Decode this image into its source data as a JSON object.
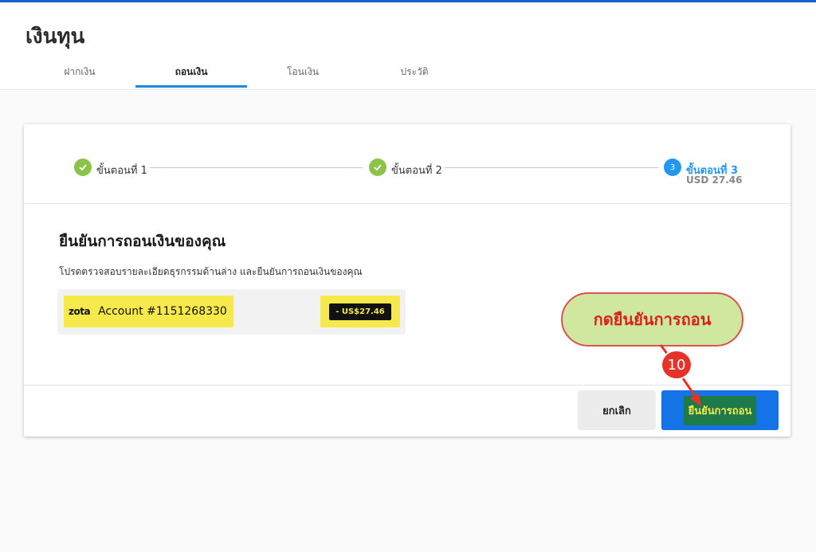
{
  "page": {
    "title": "เงินทุน"
  },
  "tabs": [
    {
      "label": "ฝากเงิน"
    },
    {
      "label": "ถอนเงิน"
    },
    {
      "label": "โอนเงิน"
    },
    {
      "label": "ประวัติ"
    }
  ],
  "stepper": {
    "steps": [
      {
        "label": "ขั้นตอนที่ 1",
        "state": "done"
      },
      {
        "label": "ขั้นตอนที่ 2",
        "state": "done"
      },
      {
        "label": "ขั้นตอนที่ 3",
        "number": "3",
        "sub": "USD 27.46",
        "state": "current"
      }
    ]
  },
  "confirm": {
    "title": "ยืนยันการถอนเงินของคุณ",
    "description": "โปรดตรวจสอบรายละเอียดธุรกรรมด้านล่าง และยืนยันการถอนเงินของคุณ",
    "logo_text": "zota",
    "account_label": "Account #1151268330",
    "amount": "-  US$27.46"
  },
  "buttons": {
    "cancel": "ยกเลิก",
    "confirm": "ยืนยันการถอน"
  },
  "annotation": {
    "callout_text": "กดยืนยันการถอน",
    "step_number": "10"
  },
  "colors": {
    "accent": "#1e88e5",
    "done": "#8bc34a",
    "highlight": "#f6e94b",
    "confirm_button": "#1473e6",
    "annotation_red": "#e5332a"
  }
}
